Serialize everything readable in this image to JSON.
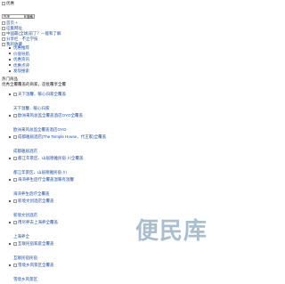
{
  "header": {
    "logo_alt": "优惠",
    "search": {
      "value": "优惠",
      "button_label": "搜索"
    },
    "links": [
      "首页 +",
      "征集网址",
      "中国最(全球)前了？—能和了解",
      "分享栏 · 不立学技",
      "我的收藏"
    ]
  },
  "nav": {
    "items": [
      "优惠推荐",
      "价值导航",
      "优惠资讯",
      "优惠点评",
      "发现搜索"
    ]
  },
  "section": {
    "title": "热门商品",
    "subtitle": "优秀全覆覆盖的商家，首批覆享全覆"
  },
  "items": [
    {
      "link": "天下温馨、暖心归家全覆盖",
      "caption": "天下温馨、暖心归家"
    },
    {
      "link": "欧洲来风总监全覆盖酒店OYO全覆盖",
      "caption": "欧洲来风总监全覆盖酒店OYO"
    },
    {
      "link": "成都雅居酒店(The Temple House，代王家)全覆盖",
      "caption": "成都雅居酒店"
    },
    {
      "link": "都江年景区、山居德雅民宿·川全覆盖",
      "caption": "都江年景区、山居德雅民宿·川"
    },
    {
      "link": "海湾养生后疗全覆盖温暖有温馨",
      "caption": "海湾养生后疗全覆盖"
    },
    {
      "link": "新境文创酒店全覆盖",
      "caption": "新境文创酒店"
    },
    {
      "link": "用尽养去上海养全覆盖",
      "caption": "上海养全"
    },
    {
      "link": "互联民宿家庭全覆盖",
      "caption": "互联民宿民宿"
    },
    {
      "link": "雪境乡风景区全覆盖",
      "caption": "雪境乡风景区"
    }
  ],
  "watermark": "便民库"
}
